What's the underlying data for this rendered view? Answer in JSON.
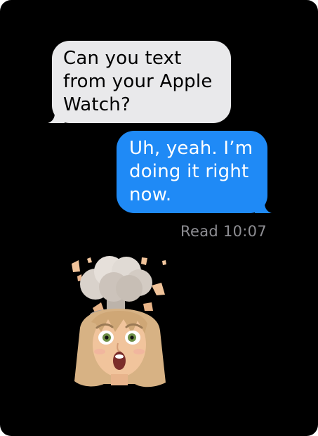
{
  "conversation": {
    "incoming_message": "Can you text\nfrom your Apple\nWatch?",
    "outgoing_message": "Uh, yeah. I’m\ndoing it right\nnow.",
    "read_receipt": "Read 10:07"
  },
  "sticker": {
    "icon": "mind-blown-memoji-sticker"
  },
  "colors": {
    "background": "#000000",
    "incoming_bubble": "#e9e9eb",
    "outgoing_bubble": "#1f8af6",
    "receipt_text": "#8e8e93"
  }
}
